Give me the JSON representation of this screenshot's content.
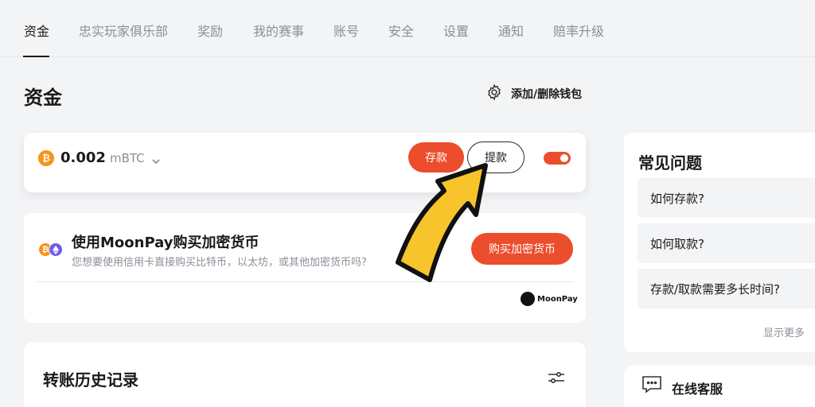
{
  "tabs": [
    {
      "label": "资金"
    },
    {
      "label": "忠实玩家俱乐部"
    },
    {
      "label": "奖励"
    },
    {
      "label": "我的赛事"
    },
    {
      "label": "账号"
    },
    {
      "label": "安全"
    },
    {
      "label": "设置"
    },
    {
      "label": "通知"
    },
    {
      "label": "赔率升级"
    }
  ],
  "page": {
    "title": "资金",
    "wallet_link": "添加/删除钱包"
  },
  "balance": {
    "coin_symbol": "₿",
    "amount": "0.002",
    "unit": "mBTC",
    "deposit_label": "存款",
    "withdraw_label": "提款",
    "toggle_on": true
  },
  "moonpay": {
    "title": "使用MoonPay购买加密货币",
    "subtitle": "您想要使用信用卡直接购买比特币，以太坊，或其他加密货币吗?",
    "buy_label": "购买加密货币",
    "logo_text": "MoonPay"
  },
  "history": {
    "title": "转账历史记录"
  },
  "faq": {
    "title": "常见问题",
    "items": [
      {
        "label": "如何存款?"
      },
      {
        "label": "如何取款?"
      },
      {
        "label": "存款/取款需要多长时间?"
      }
    ],
    "more_label": "显示更多"
  },
  "support": {
    "label": "在线客服"
  },
  "colors": {
    "accent": "#ec4d2c",
    "btc": "#f7931a",
    "eth": "#6f5be8",
    "arrow": "#f7c52b",
    "background": "#f3f4f6"
  }
}
